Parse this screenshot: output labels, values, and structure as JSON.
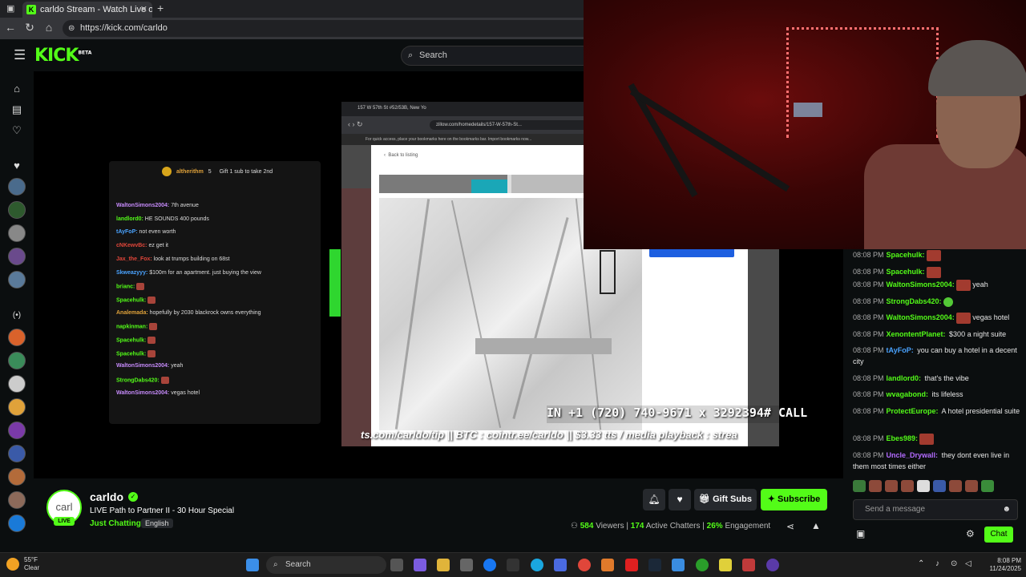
{
  "browser": {
    "tab_title": "carldo Stream - Watch Live on Kic",
    "url": "https://kick.com/carldo"
  },
  "header": {
    "logo": "KICK",
    "logo_badge": "BETA",
    "search_placeholder": "Search"
  },
  "stream_overlay": {
    "sub_goal": "altherithm",
    "sub_goal_sub": "Gift 1 sub to take 2nd",
    "sub_goal_count": "5",
    "phone_banner": "IN +1 (720) 740-9671 x 3292394#   CALL",
    "ticker": "ts.com/carldo/tip || BTC : cointr.ee/carldo || $3.33 tts / media playback : strea",
    "inner_browser_tab": "157 W 57th St #52/53B, New Yo",
    "inner_browser_url": "zillow.com/homedetails/157-W-57th-St...",
    "inner_bookmarks": "For quick access, place your bookmarks here on the bookmarks bar. Import bookmarks now...",
    "back_link": "Back to listing",
    "overlay_chat": [
      {
        "user": "WaltonSimons2004",
        "text": "7th avenue",
        "color": "#c58af9"
      },
      {
        "user": "landlord0",
        "text": "HE SOUNDS 400 pounds",
        "color": "#53fc18"
      },
      {
        "user": "tAyFoP",
        "text": "not even worth",
        "color": "#4aa3ff"
      },
      {
        "user": "cNKewvBc",
        "text": "ez get it",
        "color": "#e0463a"
      },
      {
        "user": "Jax_the_Fox",
        "text": "look at trumps building on 68st",
        "color": "#e0463a"
      },
      {
        "user": "Skweazyyy",
        "text": "$100m for an apartment. just buying the view",
        "color": "#4aa3ff"
      },
      {
        "user": "brianc",
        "text": "",
        "color": "#53fc18"
      },
      {
        "user": "Spacehulk",
        "text": "",
        "color": "#53fc18"
      },
      {
        "user": "Analemada",
        "text": "hopefully by 2030 blackrock owns everything",
        "color": "#e0a23a"
      },
      {
        "user": "napkinman",
        "text": "",
        "color": "#53fc18"
      },
      {
        "user": "Spacehulk",
        "text": "",
        "color": "#53fc18"
      },
      {
        "user": "Spacehulk",
        "text": "",
        "color": "#53fc18"
      },
      {
        "user": "WaltonSimons2004",
        "text": "yeah",
        "color": "#c58af9"
      },
      {
        "user": "StrongDabs420",
        "text": "",
        "color": "#53fc18"
      },
      {
        "user": "WaltonSimons2004",
        "text": "vegas hotel",
        "color": "#c58af9"
      }
    ]
  },
  "chat": {
    "messages": [
      {
        "time": "08:08 PM",
        "user": "Spacehulk",
        "color": "#53fc18",
        "text": "",
        "emote": true
      },
      {
        "time": "08:08 PM",
        "user": "Spacehulk",
        "color": "#53fc18",
        "text": "",
        "emote": true
      },
      {
        "time": "08:08 PM",
        "user": "WaltonSimons2004",
        "color": "#53fc18",
        "text": "yeah",
        "emote": true
      },
      {
        "time": "08:08 PM",
        "user": "StrongDabs420",
        "color": "#53fc18",
        "text": "",
        "emote_green": true
      },
      {
        "time": "08:08 PM",
        "user": "WaltonSimons2004",
        "color": "#53fc18",
        "text": "vegas hotel",
        "emote": true
      },
      {
        "time": "08:08 PM",
        "user": "XenontentPlanet",
        "color": "#53fc18",
        "text": "$300 a night suite"
      },
      {
        "time": "08:08 PM",
        "user": "tAyFoP",
        "color": "#4aa3ff",
        "text": "you can buy a hotel in a decent city"
      },
      {
        "time": "08:08 PM",
        "user": "landlord0",
        "color": "#53fc18",
        "text": "that's the vibe"
      },
      {
        "time": "08:08 PM",
        "user": "wvagabond",
        "color": "#53fc18",
        "text": "its lifeless"
      },
      {
        "time": "08:08 PM",
        "user": "ProtectEurope",
        "color": "#53fc18",
        "text": "A hotel presidential suite"
      },
      {
        "time": "08:08 PM",
        "user": "Ebes989",
        "color": "#53fc18",
        "text": "",
        "emote": true
      },
      {
        "time": "08:08 PM",
        "user": "Uncle_Drywall",
        "color": "#b36bff",
        "text": "they dont even live in them most times either"
      }
    ],
    "send_placeholder": "Send a message",
    "chat_button": "Chat"
  },
  "channel": {
    "avatar_text": "carl",
    "live_badge": "LIVE",
    "name": "carldo",
    "title": "LIVE Path to Partner II - 30 Hour Special",
    "category": "Just Chatting",
    "language": "English",
    "gift_subs": "Gift Subs",
    "subscribe": "Subscribe",
    "viewers": "584",
    "viewers_label": "Viewers",
    "chatters": "174",
    "chatters_label": "Active Chatters",
    "engagement": "26%",
    "engagement_label": "Engagement"
  },
  "taskbar": {
    "temp": "55°F",
    "condition": "Clear",
    "search": "Search",
    "time": "8:08 PM",
    "date": "11/24/2025"
  },
  "colors": {
    "accent": "#53fc18",
    "bg": "#0b0e0f"
  }
}
